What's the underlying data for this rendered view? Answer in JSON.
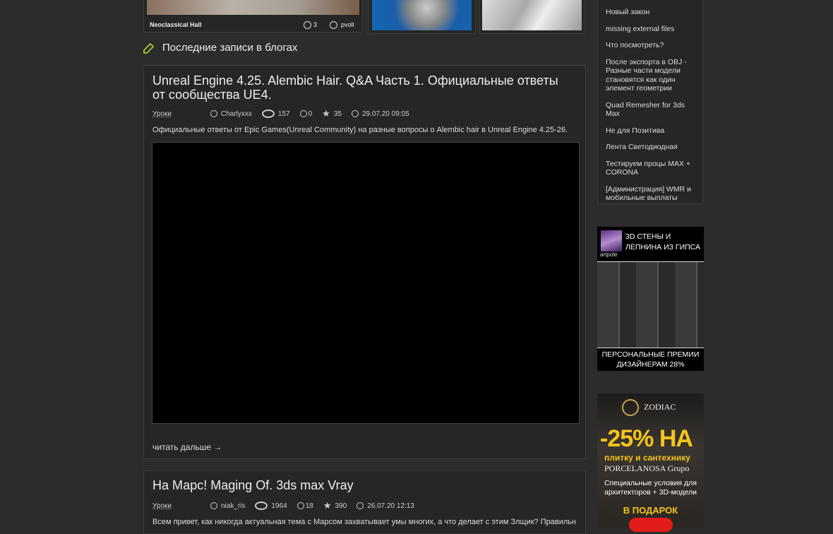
{
  "gallery": {
    "item1": {
      "title": "Neoclassical Hall",
      "comments": "3",
      "author": "pvoll"
    }
  },
  "section": {
    "title": "Последние записи в блогах"
  },
  "posts": [
    {
      "title": "Unreal Engine 4.25. Alembic Hair. Q&A Часть 1. Официальные ответы от сообщества UE4.",
      "category": "Уроки",
      "author": "Charlyxxx",
      "views": "157",
      "comments": "0",
      "rating": "35",
      "date": "29.07.20 09:05",
      "excerpt": "Официальные ответы от Epic Games(Unreal Community) на разные вопросы о Alembic hair в Unreal Engine 4.25-26.",
      "read_more": "читать дальше →"
    },
    {
      "title": "На Марс! Maging Of. 3ds max Vray",
      "category": "Уроки",
      "author": "niak_ris",
      "views": "1964",
      "comments": "18",
      "rating": "390",
      "date": "26.07.20 12:13",
      "excerpt": "Всем привет, как никогда актуальная тема с Марсом захватывает умы многих, а что делает с этим Злщик? Правильно"
    }
  ],
  "sidebar": {
    "links": [
      "Новый закон",
      "missing external files",
      "Что посмотреть?",
      "После экспорта в OBJ - Разные части модели становятся как один элемент геометрии",
      "Quad Remesher for 3ds Max",
      "Не для Позитива",
      "Лента Светодиодная",
      "Тестируем процы MAX + CORONA",
      "[Администрация] WMR и мобильные выплаты"
    ]
  },
  "ads": {
    "artpole": {
      "brand": "artpole",
      "headline": "3D СТЕНЫ И ЛЕПНИНА ИЗ ГИПСА",
      "footer": "ПЕРСОНАЛЬНЫЕ ПРЕМИИ ДИЗАЙНЕРАМ 28%"
    },
    "zodiac": {
      "brand": "ZODIAC",
      "discount": "-25% НА",
      "line1": "плитку и сантехнику",
      "line2": "PORCELANOSA Grupo",
      "line3": "Специальные условия для архитекторов + 3D-модели",
      "line4": "В ПОДАРОК"
    }
  },
  "colors": {
    "accent": "#a8c83a",
    "background": "#2c2c2c",
    "card": "#262626",
    "yellow": "#f5c518"
  }
}
